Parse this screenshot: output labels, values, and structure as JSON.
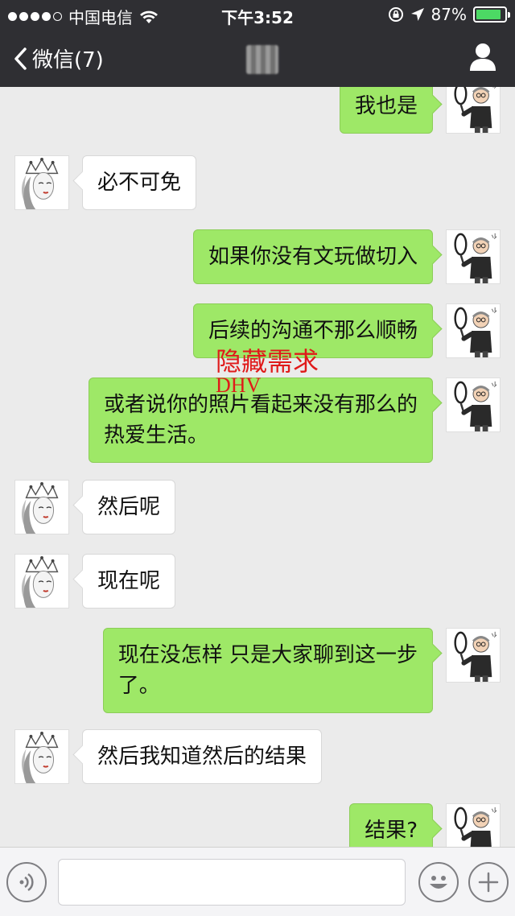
{
  "status_bar": {
    "carrier": "中国电信",
    "time": "下午3:52",
    "battery": "87%",
    "battery_level": 0.87
  },
  "nav": {
    "back_label": "微信(7)"
  },
  "messages": [
    {
      "side": "out",
      "text": "我也是"
    },
    {
      "side": "in",
      "text": "必不可免"
    },
    {
      "side": "out",
      "text": "如果你没有文玩做切入"
    },
    {
      "side": "out",
      "text": "后续的沟通不那么顺畅"
    },
    {
      "side": "out",
      "text": "或者说你的照片看起来没有那么的\n热爱生活。"
    },
    {
      "side": "in",
      "text": "然后呢"
    },
    {
      "side": "in",
      "text": "现在呢"
    },
    {
      "side": "out",
      "text": "现在没怎样 只是大家聊到这一步\n了。"
    },
    {
      "side": "in",
      "text": "然后我知道然后的结果"
    },
    {
      "side": "out",
      "text": "结果?"
    }
  ],
  "annotations": {
    "line1": "隐藏需求",
    "line2": "DHV"
  },
  "input": {
    "value": ""
  },
  "icons": [
    "chevron-left-icon",
    "profile-icon",
    "voice-icon",
    "emoji-icon",
    "plus-icon"
  ],
  "colors": {
    "nav_bg": "#2f2f33",
    "chat_bg": "#ebebeb",
    "outgoing_bubble": "#9ee867",
    "incoming_bubble": "#ffffff",
    "annotation": "#e01a1a",
    "battery": "#4cd964"
  }
}
